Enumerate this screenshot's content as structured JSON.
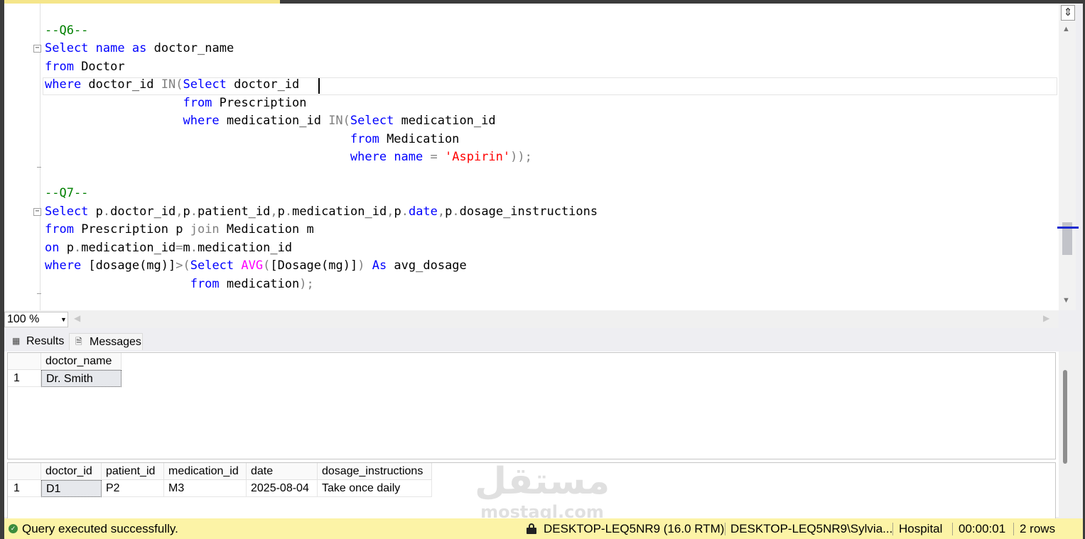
{
  "editor": {
    "lines": [
      {
        "segs": [
          {
            "t": "--Q6--",
            "c": "cm"
          }
        ]
      },
      {
        "segs": [
          {
            "t": "Select",
            "c": "kw"
          },
          {
            "t": " "
          },
          {
            "t": "name",
            "c": "kw"
          },
          {
            "t": " "
          },
          {
            "t": "as",
            "c": "kw"
          },
          {
            "t": " doctor_name"
          }
        ]
      },
      {
        "segs": [
          {
            "t": "from",
            "c": "kw"
          },
          {
            "t": " Doctor"
          }
        ]
      },
      {
        "segs": [
          {
            "t": "where",
            "c": "kw"
          },
          {
            "t": " doctor_id "
          },
          {
            "t": "IN(",
            "c": "gray"
          },
          {
            "t": "Select",
            "c": "kw"
          },
          {
            "t": " doctor_id"
          }
        ]
      },
      {
        "segs": [
          {
            "t": "                   "
          },
          {
            "t": "from",
            "c": "kw"
          },
          {
            "t": " Prescription"
          }
        ]
      },
      {
        "segs": [
          {
            "t": "                   "
          },
          {
            "t": "where",
            "c": "kw"
          },
          {
            "t": " medication_id "
          },
          {
            "t": "IN(",
            "c": "gray"
          },
          {
            "t": "Select",
            "c": "kw"
          },
          {
            "t": " medication_id"
          }
        ]
      },
      {
        "segs": [
          {
            "t": "                                          "
          },
          {
            "t": "from",
            "c": "kw"
          },
          {
            "t": " Medication"
          }
        ]
      },
      {
        "segs": [
          {
            "t": "                                          "
          },
          {
            "t": "where",
            "c": "kw"
          },
          {
            "t": " "
          },
          {
            "t": "name",
            "c": "kw"
          },
          {
            "t": " "
          },
          {
            "t": "=",
            "c": "gray"
          },
          {
            "t": " "
          },
          {
            "t": "'Aspirin'",
            "c": "str"
          },
          {
            "t": "));",
            "c": "gray"
          }
        ]
      },
      {
        "segs": []
      },
      {
        "segs": [
          {
            "t": "--Q7--",
            "c": "cm"
          }
        ]
      },
      {
        "segs": [
          {
            "t": "Select",
            "c": "kw"
          },
          {
            "t": " p"
          },
          {
            "t": ".",
            "c": "gray"
          },
          {
            "t": "doctor_id"
          },
          {
            "t": ",",
            "c": "gray"
          },
          {
            "t": "p"
          },
          {
            "t": ".",
            "c": "gray"
          },
          {
            "t": "patient_id"
          },
          {
            "t": ",",
            "c": "gray"
          },
          {
            "t": "p"
          },
          {
            "t": ".",
            "c": "gray"
          },
          {
            "t": "medication_id"
          },
          {
            "t": ",",
            "c": "gray"
          },
          {
            "t": "p"
          },
          {
            "t": ".",
            "c": "gray"
          },
          {
            "t": "date",
            "c": "kw"
          },
          {
            "t": ",",
            "c": "gray"
          },
          {
            "t": "p"
          },
          {
            "t": ".",
            "c": "gray"
          },
          {
            "t": "dosage_instructions"
          }
        ]
      },
      {
        "segs": [
          {
            "t": "from",
            "c": "kw"
          },
          {
            "t": " Prescription p "
          },
          {
            "t": "join",
            "c": "gray"
          },
          {
            "t": " Medication m"
          }
        ]
      },
      {
        "segs": [
          {
            "t": "on",
            "c": "kw"
          },
          {
            "t": " p"
          },
          {
            "t": ".",
            "c": "gray"
          },
          {
            "t": "medication_id"
          },
          {
            "t": "=",
            "c": "gray"
          },
          {
            "t": "m"
          },
          {
            "t": ".",
            "c": "gray"
          },
          {
            "t": "medication_id"
          }
        ]
      },
      {
        "segs": [
          {
            "t": "where",
            "c": "kw"
          },
          {
            "t": " [dosage(mg)]"
          },
          {
            "t": ">(",
            "c": "gray"
          },
          {
            "t": "Select",
            "c": "kw"
          },
          {
            "t": " "
          },
          {
            "t": "AVG",
            "c": "fn"
          },
          {
            "t": "(",
            "c": "gray"
          },
          {
            "t": "[Dosage(mg)]"
          },
          {
            "t": ")",
            "c": "gray"
          },
          {
            "t": " "
          },
          {
            "t": "As",
            "c": "kw"
          },
          {
            "t": " avg_dosage"
          }
        ]
      },
      {
        "segs": [
          {
            "t": "                    "
          },
          {
            "t": "from",
            "c": "kw"
          },
          {
            "t": " medication"
          },
          {
            "t": ");",
            "c": "gray"
          }
        ]
      }
    ]
  },
  "zoom": {
    "value": "100 %"
  },
  "tabs": {
    "results": "Results",
    "messages": "Messages"
  },
  "results": {
    "grid1": {
      "columns": [
        "doctor_name"
      ],
      "rows": [
        {
          "num": "1",
          "cells": [
            "Dr. Smith"
          ]
        }
      ]
    },
    "grid2": {
      "columns": [
        "doctor_id",
        "patient_id",
        "medication_id",
        "date",
        "dosage_instructions"
      ],
      "rows": [
        {
          "num": "1",
          "cells": [
            "D1",
            "P2",
            "M3",
            "2025-08-04",
            "Take once daily"
          ]
        }
      ]
    }
  },
  "watermark": {
    "arabic": "مستقل",
    "latin": "mostaql.com"
  },
  "status": {
    "message": "Query executed successfully.",
    "server": "DESKTOP-LEQ5NR9 (16.0 RTM)",
    "user": "DESKTOP-LEQ5NR9\\Sylvia...",
    "database": "Hospital",
    "elapsed": "00:00:01",
    "rows": "2 rows"
  },
  "colors": {
    "keyword": "#0000ff",
    "comment": "#008000",
    "string": "#ff0000",
    "function": "#ff00ff",
    "operator": "#808080",
    "status_bar": "#fcf3a6"
  }
}
